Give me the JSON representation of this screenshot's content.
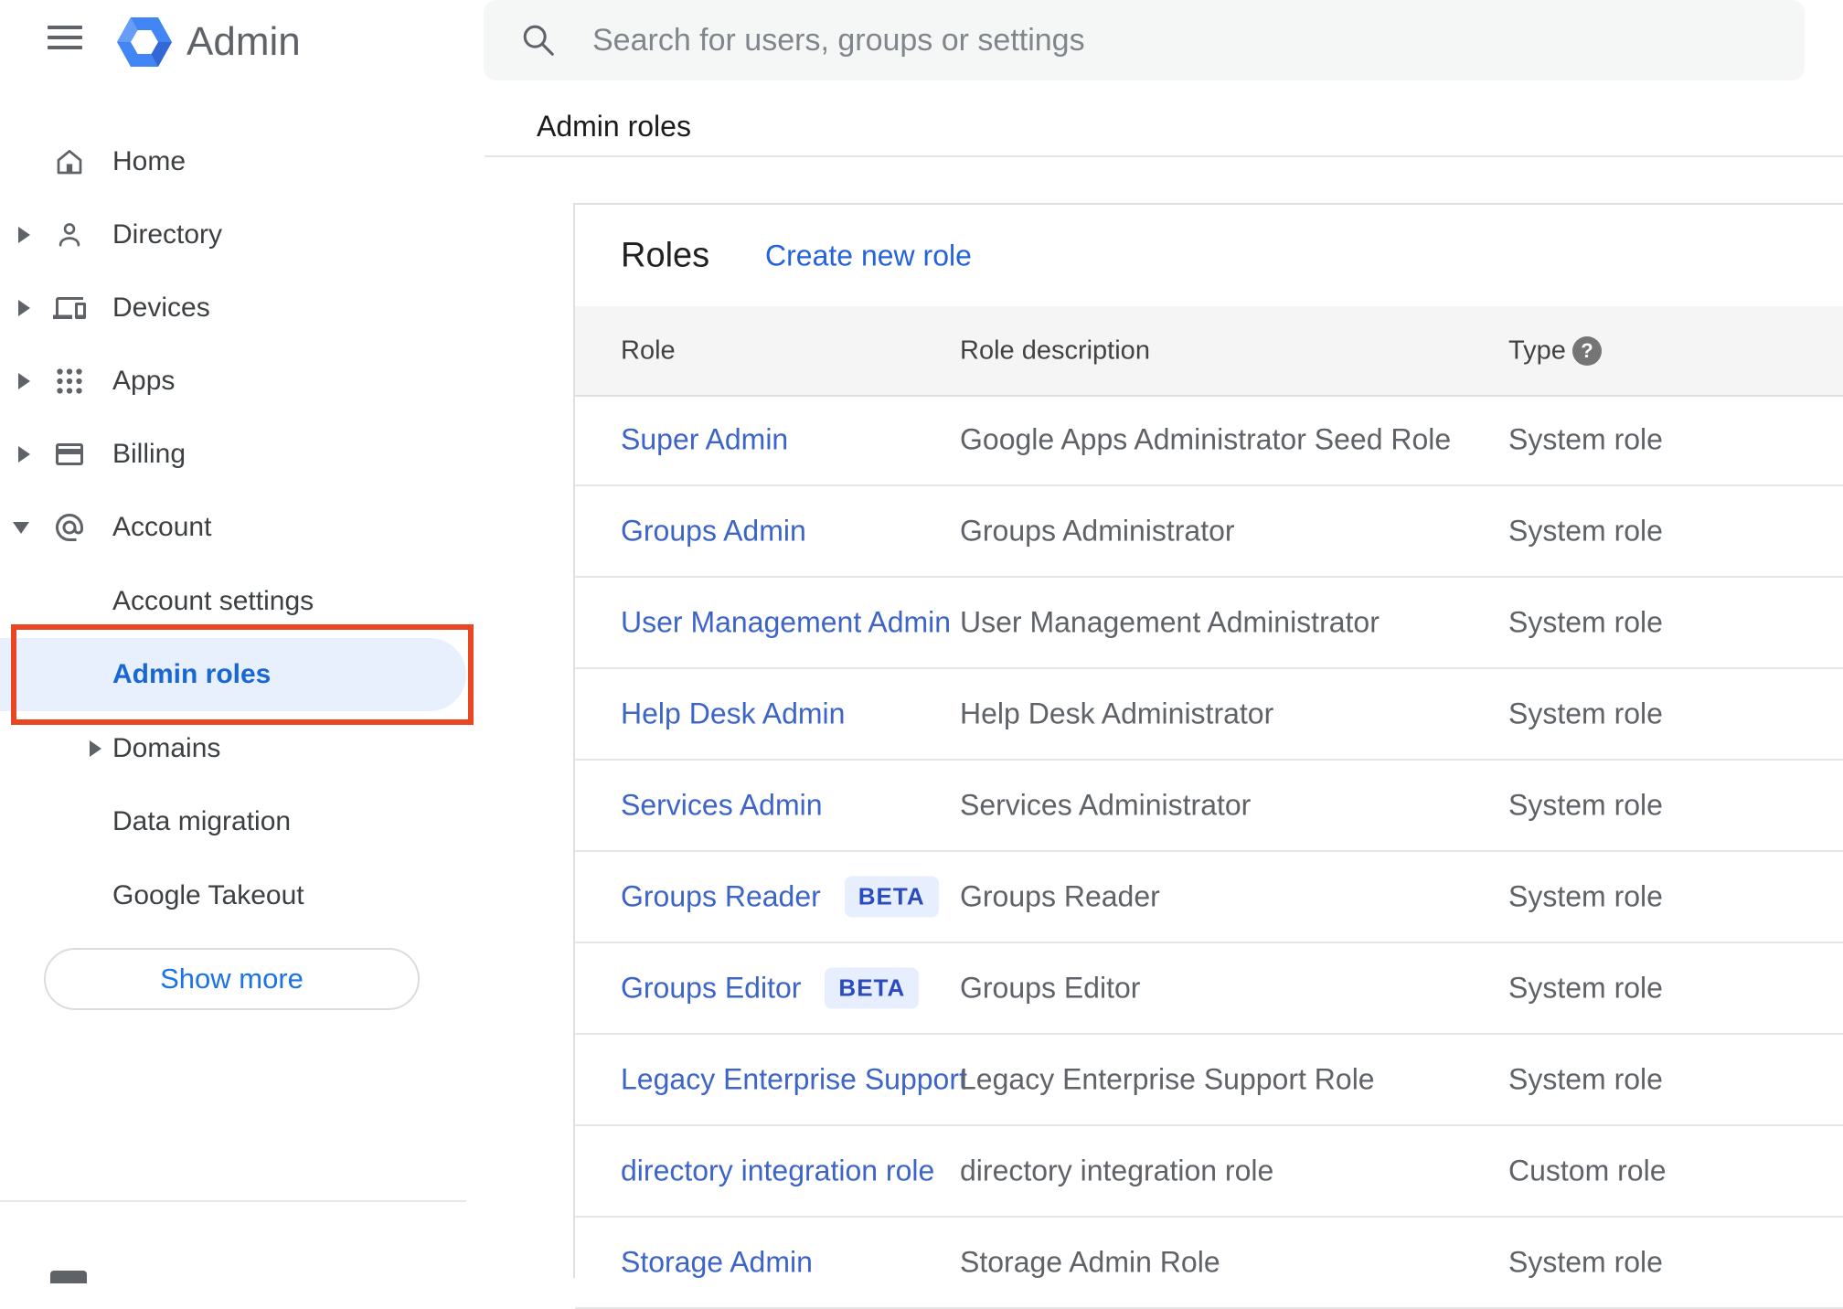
{
  "app": {
    "name": "Admin"
  },
  "search": {
    "placeholder": "Search for users, groups or settings"
  },
  "breadcrumb": {
    "label": "Admin roles"
  },
  "sidebar": {
    "items": [
      {
        "label": "Home",
        "icon": "home-icon",
        "expandable": false
      },
      {
        "label": "Directory",
        "icon": "person-icon",
        "expandable": true
      },
      {
        "label": "Devices",
        "icon": "devices-icon",
        "expandable": true
      },
      {
        "label": "Apps",
        "icon": "apps-grid-icon",
        "expandable": true
      },
      {
        "label": "Billing",
        "icon": "credit-card-icon",
        "expandable": true
      },
      {
        "label": "Account",
        "icon": "at-sign-icon",
        "expandable": true,
        "expanded": true
      }
    ],
    "children": [
      {
        "label": "Account settings",
        "selected": false
      },
      {
        "label": "Admin roles",
        "selected": true
      },
      {
        "label": "Domains",
        "expandable": true,
        "selected": false
      },
      {
        "label": "Data migration",
        "selected": false
      },
      {
        "label": "Google Takeout",
        "selected": false
      }
    ],
    "show_more_label": "Show more"
  },
  "main": {
    "title": "Roles",
    "create_link": "Create new role",
    "table": {
      "columns": [
        "Role",
        "Role description",
        "Type"
      ],
      "beta_label": "BETA",
      "rows": [
        {
          "role": "Super Admin",
          "beta": false,
          "description": "Google Apps Administrator Seed Role",
          "type": "System role"
        },
        {
          "role": "Groups Admin",
          "beta": false,
          "description": "Groups Administrator",
          "type": "System role"
        },
        {
          "role": "User Management Admin",
          "beta": false,
          "description": "User Management Administrator",
          "type": "System role"
        },
        {
          "role": "Help Desk Admin",
          "beta": false,
          "description": "Help Desk Administrator",
          "type": "System role"
        },
        {
          "role": "Services Admin",
          "beta": false,
          "description": "Services Administrator",
          "type": "System role"
        },
        {
          "role": "Groups Reader",
          "beta": true,
          "description": "Groups Reader",
          "type": "System role"
        },
        {
          "role": "Groups Editor",
          "beta": true,
          "description": "Groups Editor",
          "type": "System role"
        },
        {
          "role": "Legacy Enterprise Support",
          "beta": false,
          "description": "Legacy Enterprise Support Role",
          "type": "System role"
        },
        {
          "role": "directory integration role",
          "beta": false,
          "description": "directory integration role",
          "type": "Custom role"
        },
        {
          "role": "Storage Admin",
          "beta": false,
          "description": "Storage Admin Role",
          "type": "System role"
        }
      ]
    }
  },
  "colors": {
    "accent_blue": "#1a73e8",
    "selected_blue": "#1967d2",
    "selected_bg": "#e8f0fe",
    "table_link_blue": "#3c64c9",
    "annotation_red": "#e94724",
    "icon_gray": "#5f6368",
    "header_bg": "#f5f5f5",
    "search_bg": "#f5f6f6"
  }
}
